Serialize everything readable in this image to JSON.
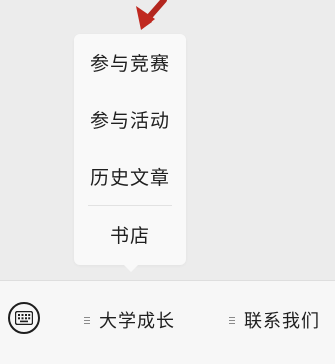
{
  "menu": {
    "items": [
      {
        "label": "参与竞赛"
      },
      {
        "label": "参与活动"
      },
      {
        "label": "历史文章"
      },
      {
        "label": "书店"
      }
    ]
  },
  "bottom_bar": {
    "keyboard_icon": "keyboard-icon",
    "tabs": [
      {
        "label": "大学成长",
        "icon": "menu-lines-icon"
      },
      {
        "label": "联系我们",
        "icon": "menu-lines-icon"
      }
    ]
  },
  "colors": {
    "annotation_arrow": "#b3261e",
    "background": "#ececec",
    "popup": "#f9f9f9"
  }
}
